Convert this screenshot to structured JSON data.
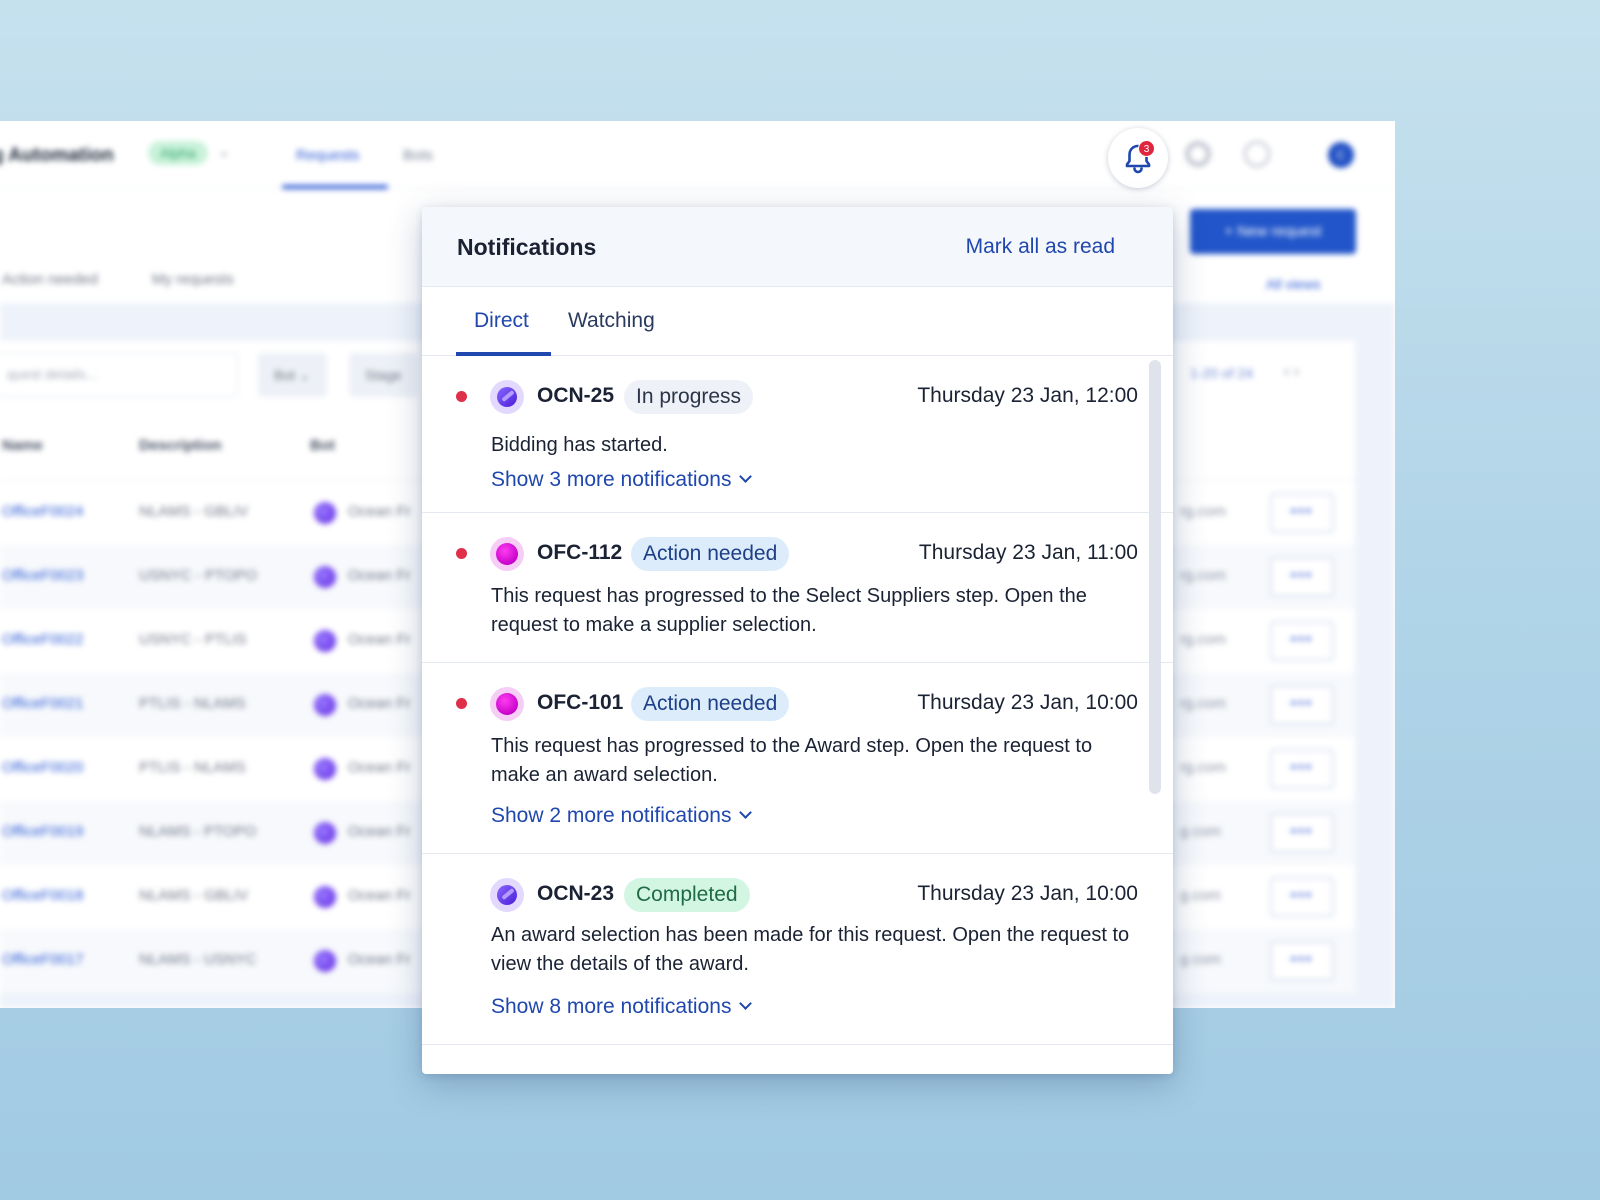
{
  "app": {
    "title": "g Automation",
    "badge": "Alpha",
    "nav": {
      "requests": "Requests",
      "bots": "Bots"
    },
    "subtabs": {
      "action_needed": "Action needed",
      "my_requests": "My requests"
    },
    "new_request_label": "+  New request",
    "all_views_label": "All views",
    "search_placeholder": "quest details...",
    "filters": {
      "bot": "Bot ⌄",
      "stage": "Stage"
    },
    "pager_label": "1-20 of 24",
    "avatar_initial": "C",
    "columns": {
      "name": "Name",
      "description": "Description",
      "bot": "Bot"
    },
    "rows": [
      {
        "name": "OfficeF0024",
        "description": "NLAMS - GBLIV",
        "bot": "Ocean Fr",
        "email": "rg.com"
      },
      {
        "name": "OfficeF0023",
        "description": "USNYC - PTOPO",
        "bot": "Ocean Fr",
        "email": "rg.com"
      },
      {
        "name": "OfficeF0022",
        "description": "USNYC - PTLIS",
        "bot": "Ocean Fr",
        "email": "rg.com"
      },
      {
        "name": "OfficeF0021",
        "description": "PTLIS - NLAMS",
        "bot": "Ocean Fr",
        "email": "rg.com"
      },
      {
        "name": "OfficeF0020",
        "description": "PTLIS - NLAMS",
        "bot": "Ocean Fr",
        "email": "rg.com"
      },
      {
        "name": "OfficeF0019",
        "description": "NLAMS - PTOPO",
        "bot": "Ocean Fr",
        "email": "g.com"
      },
      {
        "name": "OfficeF0018",
        "description": "NLAMS - GBLIV",
        "bot": "Ocean Fr",
        "email": "g.com"
      },
      {
        "name": "OfficeF0017",
        "description": "NLAMS - USNYC",
        "bot": "Ocean Fr",
        "email": "g.com"
      }
    ]
  },
  "bell": {
    "badge_count": "3"
  },
  "notifications": {
    "title": "Notifications",
    "mark_all_label": "Mark all as read",
    "tabs": {
      "direct": "Direct",
      "watching": "Watching"
    },
    "items": [
      {
        "code": "OCN-25",
        "status": "In progress",
        "time": "Thursday 23 Jan, 12:00",
        "message": "Bidding has started.",
        "more": "Show 3 more notifications"
      },
      {
        "code": "OFC-112",
        "status": "Action needed",
        "time": "Thursday 23 Jan, 11:00",
        "message": "This request has progressed to the Select Suppliers step. Open the request to make a supplier selection."
      },
      {
        "code": "OFC-101",
        "status": "Action needed",
        "time": "Thursday 23 Jan, 10:00",
        "message": "This request has progressed to the Award step. Open the request to make an award selection.",
        "more": "Show 2 more notifications"
      },
      {
        "code": "OCN-23",
        "status": "Completed",
        "time": "Thursday 23 Jan, 10:00",
        "message": "An award selection has been made for this request. Open the request to view the details of the award.",
        "more": "Show 8 more notifications"
      }
    ]
  },
  "colors": {
    "brand_blue": "#1f47ad",
    "unread_red": "#de2f4b",
    "completed_green": "#d3f6e2"
  }
}
